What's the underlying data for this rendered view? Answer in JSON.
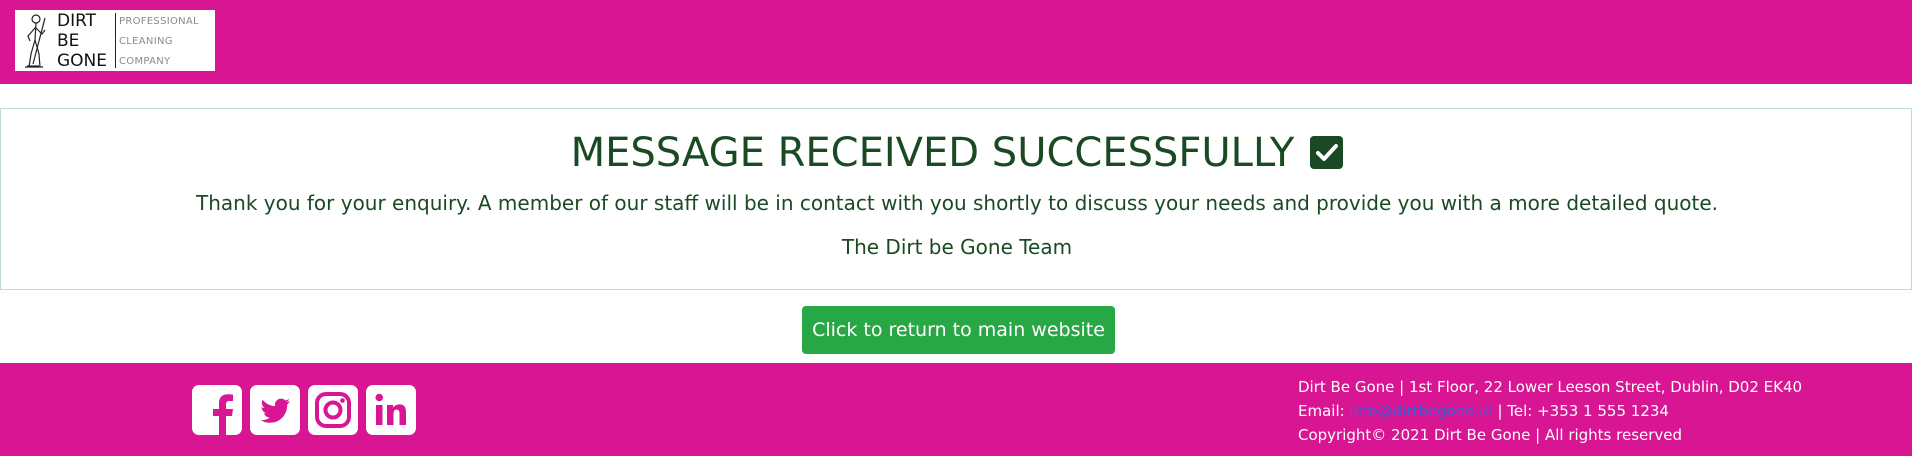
{
  "header": {
    "logo": {
      "main_lines": [
        "DIRT",
        "BE",
        "GONE"
      ],
      "sub_lines": [
        "PROFESSIONAL",
        "CLEANING",
        "COMPANY"
      ]
    }
  },
  "message": {
    "title": "MESSAGE RECEIVED SUCCESSFULLY",
    "body": "Thank you for your enquiry. A member of our staff will be in contact with you shortly to discuss your needs and provide you with a more detailed quote.",
    "signature": "The Dirt be Gone Team"
  },
  "return_button": {
    "label": "Click to return to main website"
  },
  "footer": {
    "social_icons": [
      "facebook-icon",
      "twitter-icon",
      "instagram-icon",
      "linkedin-icon"
    ],
    "address": "Dirt Be Gone | 1st Floor, 22 Lower Leeson Street, Dublin, D02 EK40",
    "email_label": "Email: ",
    "email": "info@dirtbegone.ie",
    "tel": " | Tel: +353 1 555 1234",
    "copyright": "Copyright© 2021 Dirt Be Gone | All rights reserved"
  },
  "colors": {
    "brand_magenta": "#d81592",
    "dark_green_text": "#1a4a23",
    "button_green": "#28a745",
    "link_blue": "#3b5fd9"
  }
}
